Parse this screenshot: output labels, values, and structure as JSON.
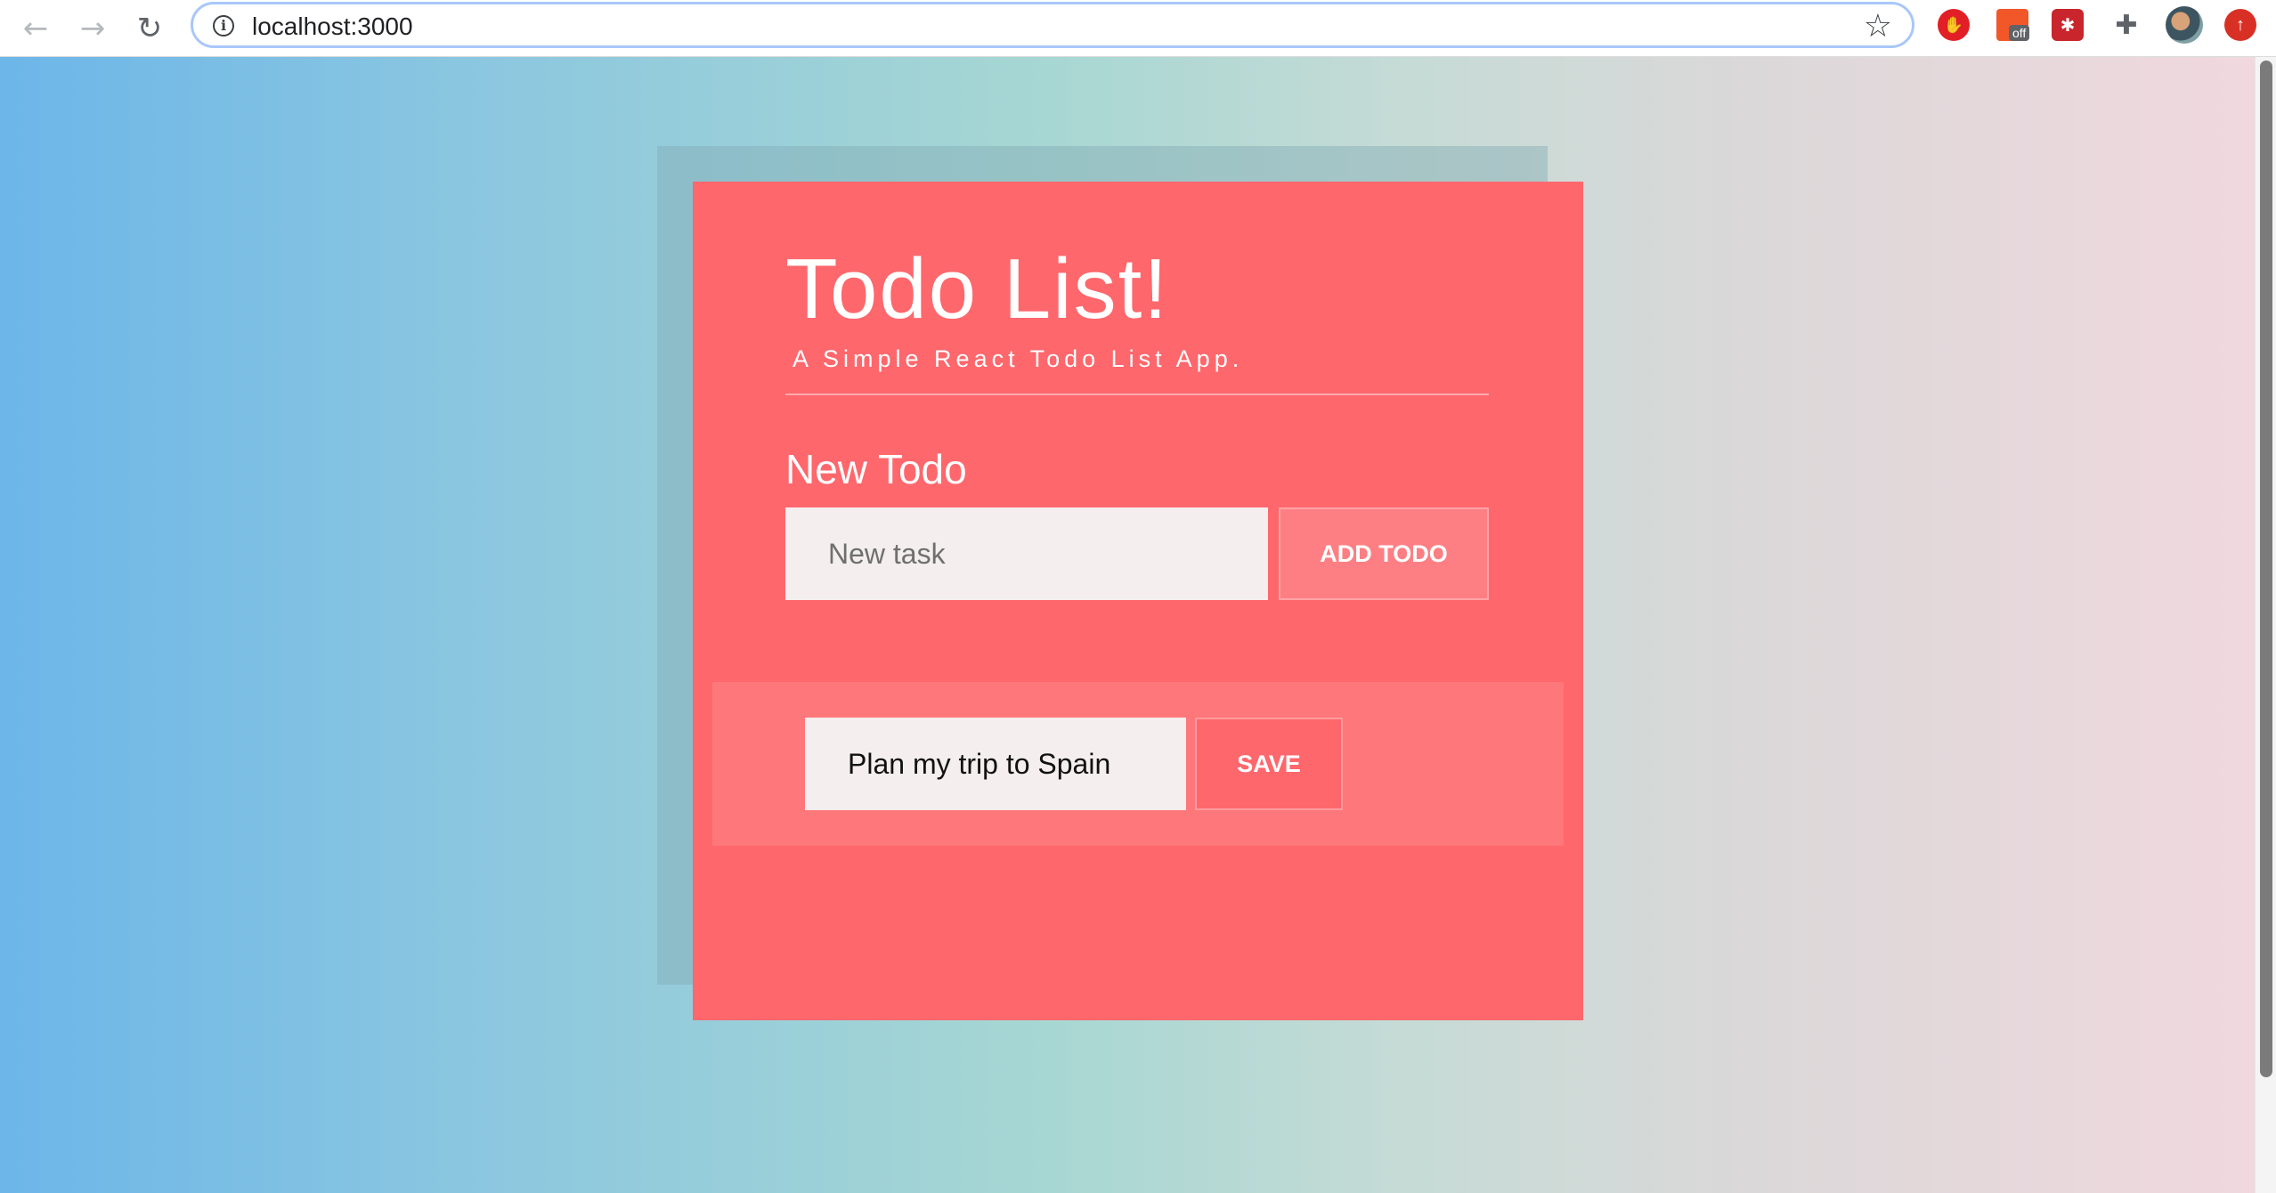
{
  "browser": {
    "url": "localhost:3000",
    "back_icon": "←",
    "forward_icon": "→",
    "reload_icon": "↻",
    "info_icon": "i",
    "star_icon": "☆",
    "extensions": {
      "ublock_label": "off"
    }
  },
  "app": {
    "title": "Todo List!",
    "subtitle": "A Simple React Todo List App.",
    "new_todo_label": "New Todo",
    "new_task_placeholder": "New task",
    "add_button_label": "ADD TODO",
    "todos": [
      {
        "value": "Plan my trip to Spain",
        "save_label": "SAVE"
      }
    ]
  },
  "colors": {
    "card": "#fe676c",
    "todo_row": "#fe777b",
    "input_bg": "#f5eeee",
    "gradient_start": "#6cb6e9",
    "gradient_end": "#f1d8de"
  }
}
